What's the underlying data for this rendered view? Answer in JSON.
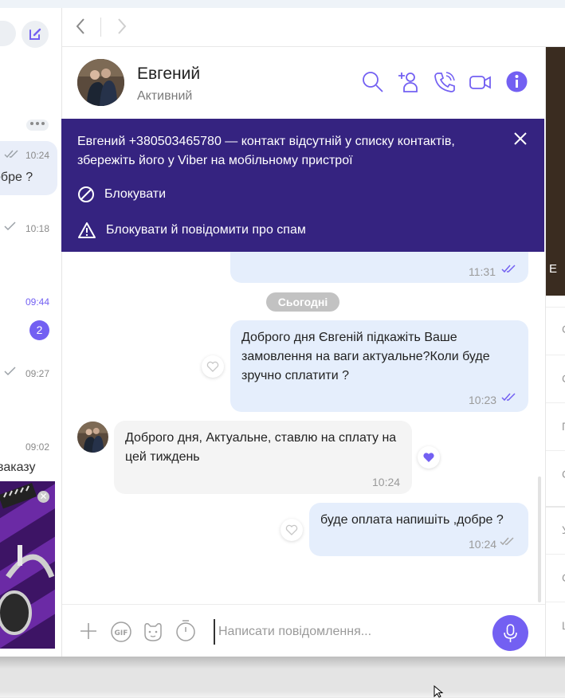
{
  "colors": {
    "accent": "#7360f2",
    "banner_bg": "#352380",
    "outgoing_bubble": "#e5eefc",
    "incoming_bubble": "#f4f4f4",
    "icon": "#7360f2"
  },
  "chat_list": {
    "items": [
      {
        "time": "10:24",
        "snippet": "обре ?",
        "status_icon": "double-check-icon"
      },
      {
        "time": "10:18",
        "status_icon": "check-icon"
      },
      {
        "time": "09:44",
        "unread": "2"
      },
      {
        "time": "09:27",
        "status_icon": "check-icon"
      },
      {
        "time": "09:02",
        "snippet": "ваказу"
      }
    ]
  },
  "header": {
    "contact_name": "Евгений",
    "contact_status": "Активний",
    "icons": [
      "search-icon",
      "add-participant-icon",
      "call-icon",
      "video-call-icon",
      "info-icon"
    ]
  },
  "banner": {
    "text": "Евгений +380503465780 — контакт відсутній у списку контактів, збережіть його у Viber на мобільному пристрої",
    "block_label": "Блокувати",
    "block_spam_label": "Блокувати й повідомити про спам"
  },
  "messages": {
    "prev_time": "11:31",
    "date_separator": "Сьогодні",
    "items": [
      {
        "direction": "out",
        "text": "Доброго дня Євгеній підкажіть Ваше замовлення на ваги актуальне?Коли буде зручно сплатити ?",
        "time": "10:23"
      },
      {
        "direction": "in",
        "text": "Доброго дня, Актуальне,  ставлю на сплату на цей тиждень",
        "time": "10:24"
      },
      {
        "direction": "out",
        "text": "буде оплата напишіть ,добре ?",
        "time": "10:24"
      }
    ]
  },
  "composer": {
    "placeholder": "Написати повідомлення..."
  }
}
